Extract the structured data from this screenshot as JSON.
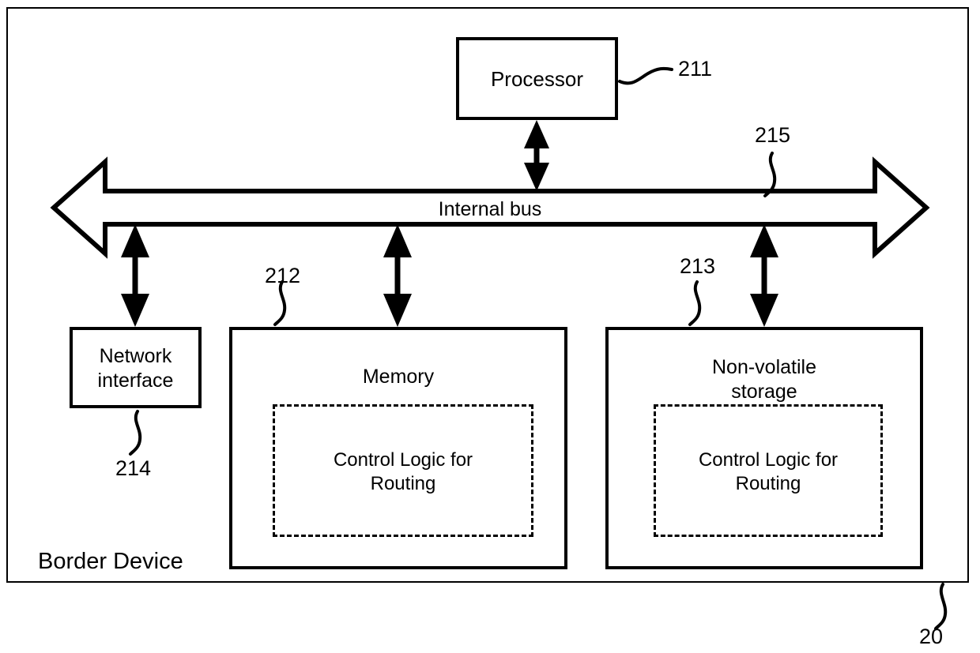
{
  "figure": {
    "outer_frame_label": "Border Device",
    "outer_frame_ref": "20"
  },
  "blocks": {
    "processor": {
      "label": "Processor",
      "ref": "211"
    },
    "network_interface": {
      "label": "Network\ninterface",
      "ref": "214"
    },
    "memory": {
      "label": "Memory",
      "ref": "212",
      "inner_label": "Control Logic for\nRouting"
    },
    "nonvolatile_storage": {
      "label": "Non-volatile\nstorage",
      "ref": "213",
      "inner_label": "Control Logic for\nRouting"
    }
  },
  "bus": {
    "label": "Internal bus",
    "ref": "215"
  },
  "colors": {
    "stroke": "#000000",
    "background": "#ffffff"
  }
}
